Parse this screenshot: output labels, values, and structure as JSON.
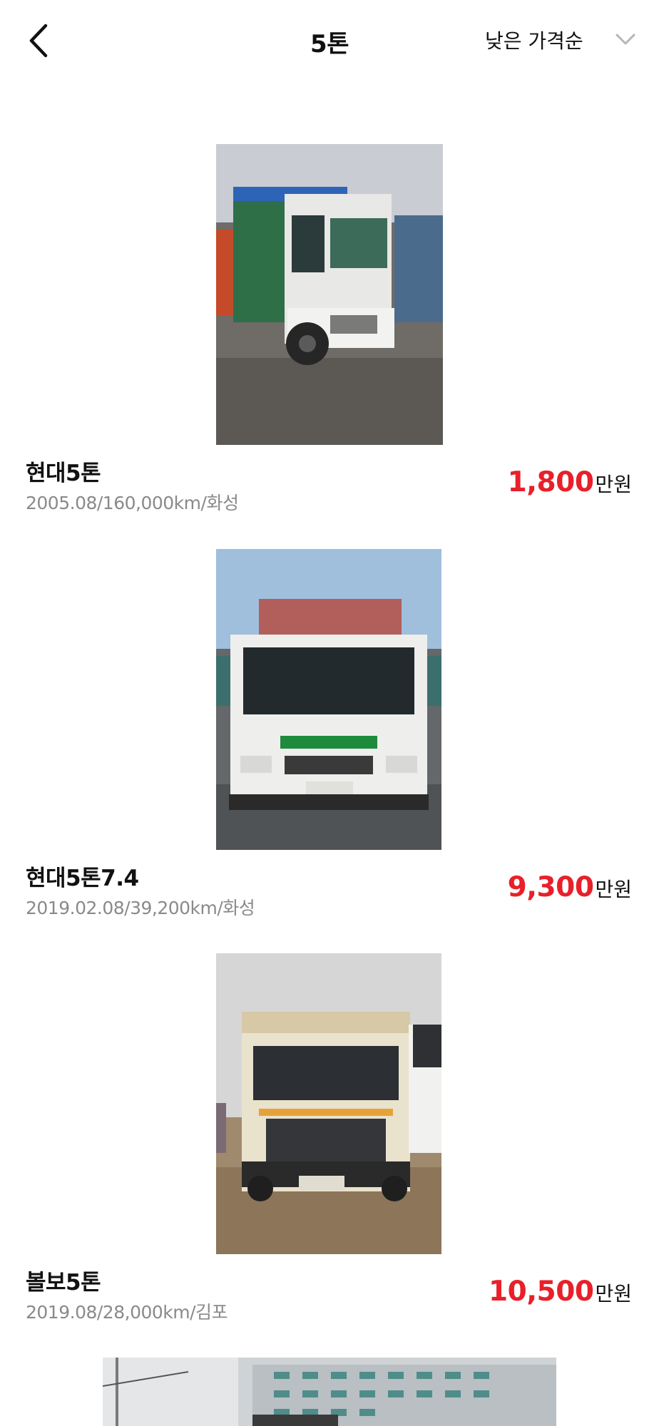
{
  "header": {
    "title": "5톤",
    "sort_label": "낮은 가격순",
    "back_icon": "chevron-left-icon",
    "sort_icon": "chevron-down-icon"
  },
  "colors": {
    "price": "#e8202a",
    "meta": "#8a8a8a",
    "text": "#111111"
  },
  "listings": [
    {
      "name": "현대5톤",
      "meta": "2005.08/160,000km/화성",
      "price": "1,800",
      "unit": "만원"
    },
    {
      "name": "현대5톤7.4",
      "meta": "2019.02.08/39,200km/화성",
      "price": "9,300",
      "unit": "만원"
    },
    {
      "name": "볼보5톤",
      "meta": "2019.08/28,000km/김포",
      "price": "10,500",
      "unit": "만원"
    }
  ]
}
